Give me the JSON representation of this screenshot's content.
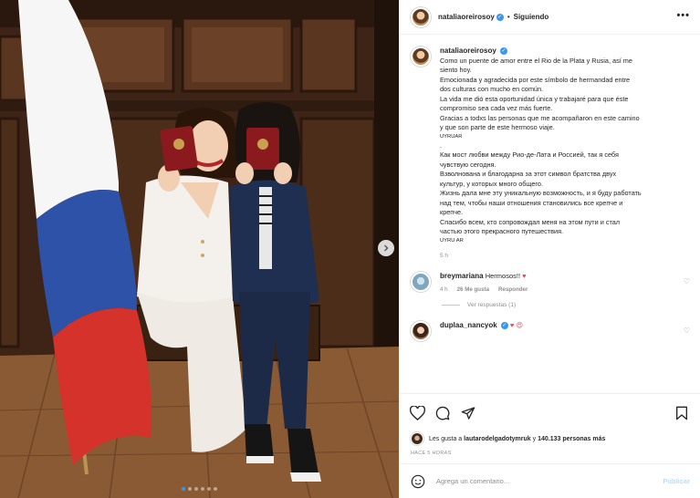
{
  "post": {
    "username": "nataliaoreirosoy",
    "separator": "•",
    "follow_status": "Siguiendo",
    "more_icon": "more-horizontal-icon",
    "verified_glyph": "✓"
  },
  "caption": {
    "username": "nataliaoreirosoy",
    "lines": [
      "Como un puente de amor entre el Rio de la Plata y Rusia, así me",
      "siento hoy.",
      "Emocionada y agradecida por este símbolo de hermandad entre",
      "dos culturas con mucho en común.",
      "La vida me dió esta oportunidad única y trabajaré para que éste",
      "compromiso sea cada vez más fuerte.",
      "Gracias a todxs las personas que me acompañaron en este camino",
      "y que son parte de este hermoso viaje."
    ],
    "flag_tag_1": "UYRUAR",
    "dot": ".",
    "russian_lines": [
      "Как мост любви между Рио-де-Лата и Россией, так я себя",
      "чувствую сегодня.",
      "Взволнована и благодарна за этот символ братства двух",
      "культур, у которых много общего.",
      "Жизнь дала мне эту уникальную возможность, и я буду работать",
      "над тем, чтобы наши отношения становились все крепче и",
      "крепче.",
      "Спасибо всем, кто сопровождал меня на этом пути и стал",
      "частью этого прекрасного путешествия."
    ],
    "flag_tag_2": "UYRU AR",
    "time": "5 h"
  },
  "comments": [
    {
      "username": "breymariana",
      "text": "Hermosos!!",
      "emoji": "♥",
      "time": "4 h",
      "likes": "26 Me gusta",
      "reply": "Responder",
      "view_replies": "Ver respuestas (1)"
    },
    {
      "username": "duplaa_nancyok",
      "text": "",
      "emoji": "♥ 😍"
    }
  ],
  "actions": {
    "likes_prefix": "Les gusta a",
    "liker": "lautarodelgadotymruk",
    "likes_and": "y",
    "likes_count": "140.133 personas más",
    "posted_ago": "HACE 5 HORAS"
  },
  "add_comment": {
    "placeholder": "Agrega un comentario...",
    "publish": "Publicar"
  },
  "carousel": {
    "total": 6,
    "active_index": 0,
    "active_color": "#3897f0"
  },
  "colors": {
    "text": "#262626",
    "secondary": "#8e8e8e",
    "link_blue": "#3897f0",
    "heart_red": "#ed4956",
    "publish_disabled": "#b2dffc"
  }
}
